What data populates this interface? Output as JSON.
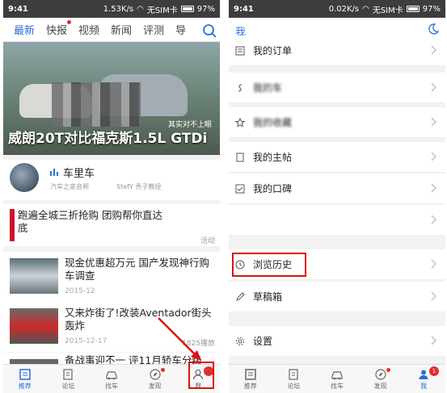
{
  "left": {
    "status": {
      "time": "9:41",
      "speed": "1.53K/s",
      "sim": "无SIM卡",
      "battery": "97%"
    },
    "tabs": [
      {
        "label": "最新",
        "active": true
      },
      {
        "label": "快报",
        "dot": true
      },
      {
        "label": "视频"
      },
      {
        "label": "新闻"
      },
      {
        "label": "评测"
      },
      {
        "label": "导"
      }
    ],
    "hero": {
      "caption": "其实对不上眼",
      "title": "威朗20T对比福克斯1.5L GTDi"
    },
    "audio": {
      "name": "车里车",
      "meta1": "汽车之家音频",
      "meta2": "StefY 秃子教授"
    },
    "news": [
      {
        "title": "跑遍全城三折抢购 团购帮你直达底",
        "date": "",
        "tag": "活动"
      },
      {
        "title": "现金优惠超万元 国产发现神行购车调查",
        "date": "2015-12",
        "tag": ""
      },
      {
        "title": "又来炸街了!改装Aventador街头轰炸",
        "date": "2015-12-17",
        "tag": "1825播放"
      },
      {
        "title": "备战事迎不一 评11月轿车分级别销",
        "date": "",
        "tag": ""
      }
    ],
    "nav": [
      {
        "label": "推荐",
        "icon": "home-icon",
        "active": true
      },
      {
        "label": "论坛",
        "icon": "forum-icon"
      },
      {
        "label": "找车",
        "icon": "car-icon"
      },
      {
        "label": "发现",
        "icon": "compass-icon",
        "dot": true
      },
      {
        "label": "我",
        "icon": "user-icon",
        "badge": ""
      }
    ]
  },
  "right": {
    "status": {
      "time": "9:41",
      "speed": "0.02K/s",
      "sim": "无SIM卡",
      "battery": "97%"
    },
    "header": {
      "title": "我"
    },
    "menu": [
      {
        "label": "我的订单",
        "icon": "order-icon"
      },
      {
        "label": "我的车",
        "icon": "dollar-icon",
        "blurred": true
      },
      {
        "label": "我的收藏",
        "icon": "star-icon",
        "blurred": true
      },
      {
        "label": "我的主帖",
        "icon": "document-icon"
      },
      {
        "label": "我的口碑",
        "icon": "check-icon"
      },
      {
        "label": "",
        "icon": ""
      },
      {
        "label": "浏览历史",
        "icon": "clock-icon"
      },
      {
        "label": "草稿箱",
        "icon": "pencil-icon"
      },
      {
        "label": "设置",
        "icon": "gear-icon"
      }
    ],
    "nav": [
      {
        "label": "推荐",
        "icon": "home-icon"
      },
      {
        "label": "论坛",
        "icon": "forum-icon"
      },
      {
        "label": "找车",
        "icon": "car-icon"
      },
      {
        "label": "发现",
        "icon": "compass-icon",
        "dot": true
      },
      {
        "label": "我",
        "icon": "user-icon",
        "badge": "1",
        "active": true
      }
    ]
  },
  "colors": {
    "accent": "#2b6fd8",
    "highlight": "#e01010",
    "badge": "#e03030"
  }
}
